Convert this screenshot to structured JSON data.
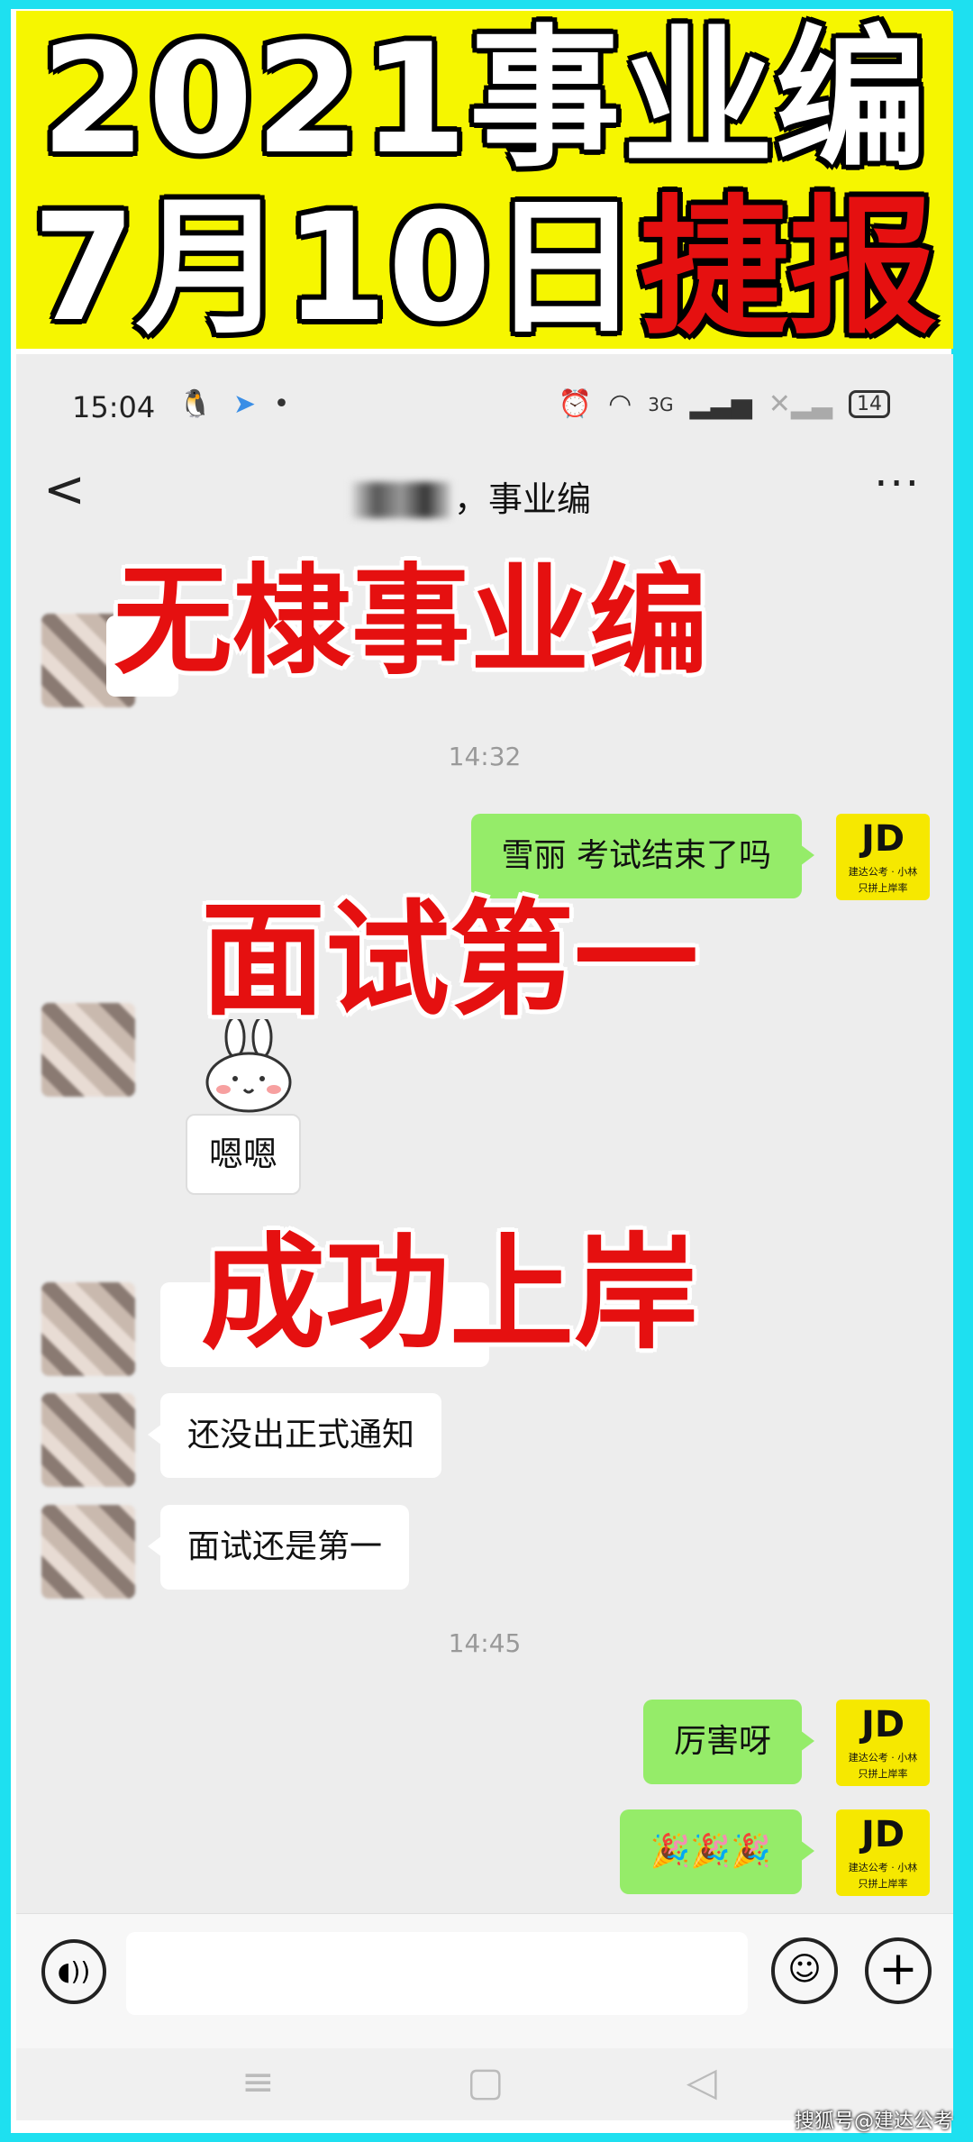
{
  "banner": {
    "line1": "2021事业编",
    "line2_white": "7月10日",
    "line2_red": "捷报"
  },
  "status_bar": {
    "time": "15:04",
    "network": "3G",
    "battery": "14"
  },
  "chat": {
    "title": "，事业编",
    "timestamps": [
      "14:32",
      "14:45"
    ],
    "messages": {
      "me_1": "雪丽 考试结束了吗",
      "other_sticker_reply": "嗯嗯",
      "other_1": "还没出正式通知",
      "other_2": "面试还是第一",
      "me_2": "厉害呀",
      "me_3": "🎉🎉🎉"
    },
    "my_avatar": {
      "logo": "JD",
      "line1": "建达公考 · 小林",
      "line2": "只拼上岸率"
    }
  },
  "overlays": {
    "o1": "无棣事业编",
    "o2": "面试第一",
    "o3": "成功上岸"
  },
  "watermark": "搜狐号@建达公考",
  "colors": {
    "banner_bg": "#f6f600",
    "frame_bg": "#1ee0f0",
    "overlay_red": "#e51010",
    "my_bubble": "#95ec69"
  }
}
